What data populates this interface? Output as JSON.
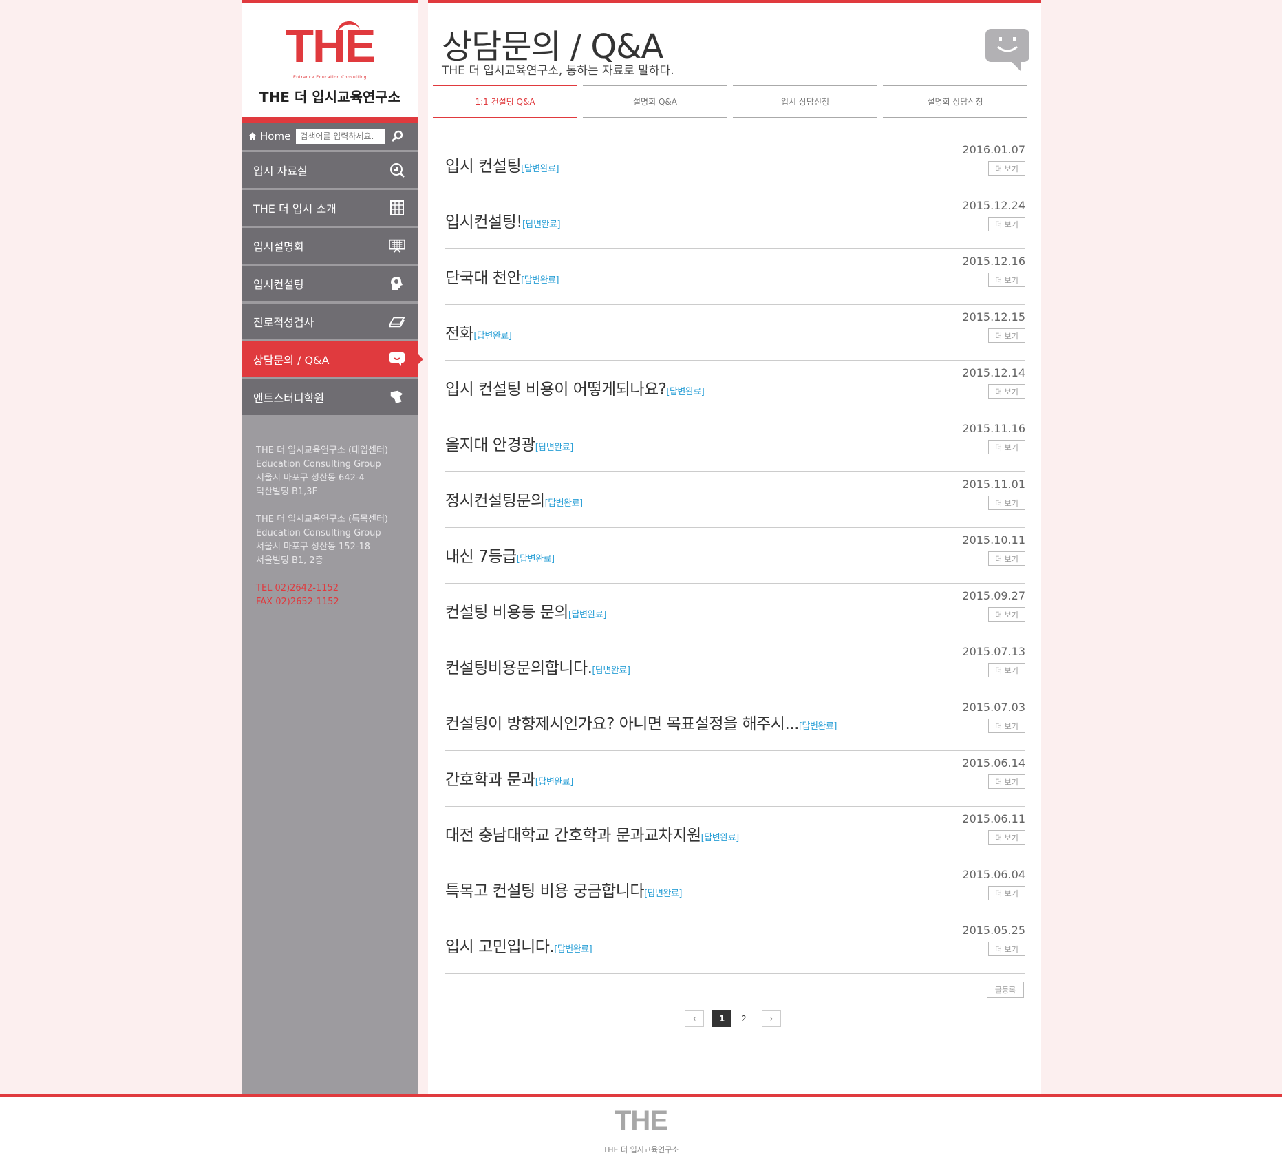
{
  "logo": {
    "mark": "THE",
    "sub": "Entrance Education Consulting",
    "name": "THE 더 입시교육연구소"
  },
  "search": {
    "home_label": "Home",
    "placeholder": "검색어를 입력하세요."
  },
  "sidebar": {
    "items": [
      {
        "label": "입시 자료실",
        "icon": "chart-search-icon"
      },
      {
        "label": "THE 더 입시 소개",
        "icon": "building-icon"
      },
      {
        "label": "입시설명회",
        "icon": "presentation-board-icon"
      },
      {
        "label": "입시컨설팅",
        "icon": "head-idea-icon"
      },
      {
        "label": "진로적성검사",
        "icon": "eraser-icon"
      },
      {
        "label": "상담문의 / Q&A",
        "icon": "chat-bubble-icon",
        "active": true
      },
      {
        "label": "앤트스터디학원",
        "icon": "ant-icon"
      }
    ],
    "address": {
      "center1": [
        "THE 더 입시교육연구소 (대입센터)",
        "Education Consulting Group",
        "서울시 마포구 성산동 642-4",
        "덕산빌딩 B1,3F"
      ],
      "center2": [
        "THE 더 입시교육연구소 (특목센터)",
        "Education Consulting Group",
        "서울시 마포구 성산동 152-18",
        "서울빌딩 B1, 2층"
      ],
      "tel": "TEL 02)2642-1152",
      "fax": "FAX 02)2652-1152"
    }
  },
  "header": {
    "title": "상담문의 / Q&A",
    "subtitle": "THE 더 입시교육연구소, 통하는 자료로 말하다."
  },
  "tabs": [
    {
      "label": "1:1 컨설팅 Q&A",
      "active": true
    },
    {
      "label": "설명회 Q&A"
    },
    {
      "label": "입시 상담신청"
    },
    {
      "label": "설명회 상담신청"
    }
  ],
  "posts": [
    {
      "title": "입시 컨설팅",
      "status": "[답변완료]",
      "date": "2016.01.07"
    },
    {
      "title": "입시컨설팅!",
      "status": "[답변완료]",
      "date": "2015.12.24"
    },
    {
      "title": "단국대 천안",
      "status": "[답변완료]",
      "date": "2015.12.16"
    },
    {
      "title": "전화",
      "status": "[답변완료]",
      "date": "2015.12.15"
    },
    {
      "title": "입시 컨설팅 비용이 어떻게되나요?",
      "status": "[답변완료]",
      "date": "2015.12.14"
    },
    {
      "title": "을지대 안경광",
      "status": "[답변완료]",
      "date": "2015.11.16"
    },
    {
      "title": "정시컨설팅문의",
      "status": "[답변완료]",
      "date": "2015.11.01"
    },
    {
      "title": "내신 7등급",
      "status": "[답변완료]",
      "date": "2015.10.11"
    },
    {
      "title": "컨설팅 비용등 문의",
      "status": "[답변완료]",
      "date": "2015.09.27"
    },
    {
      "title": "컨설팅비용문의합니다.",
      "status": "[답변완료]",
      "date": "2015.07.13"
    },
    {
      "title": "컨설팅이 방향제시인가요? 아니면 목표설정을 해주시...",
      "status": "[답변완료]",
      "date": "2015.07.03"
    },
    {
      "title": "간호학과 문과",
      "status": "[답변완료]",
      "date": "2015.06.14"
    },
    {
      "title": "대전 충남대학교 간호학과 문과교차지원",
      "status": "[답변완료]",
      "date": "2015.06.11"
    },
    {
      "title": "특목고 컨설팅 비용 궁금합니다",
      "status": "[답변완료]",
      "date": "2015.06.04"
    },
    {
      "title": "입시 고민입니다.",
      "status": "[답변완료]",
      "date": "2015.05.25"
    }
  ],
  "more_label": "더 보기",
  "write_label": "글등록",
  "pager": {
    "prev": "‹",
    "next": "›",
    "pages": [
      "1",
      "2"
    ],
    "current": "1"
  },
  "footer": {
    "mark": "THE",
    "name": "THE 더 입시교육연구소"
  },
  "colors": {
    "accent": "#e03a3e",
    "status": "#2a9fd6",
    "sidebar": "#6f6d72",
    "background": "#fcefef"
  }
}
